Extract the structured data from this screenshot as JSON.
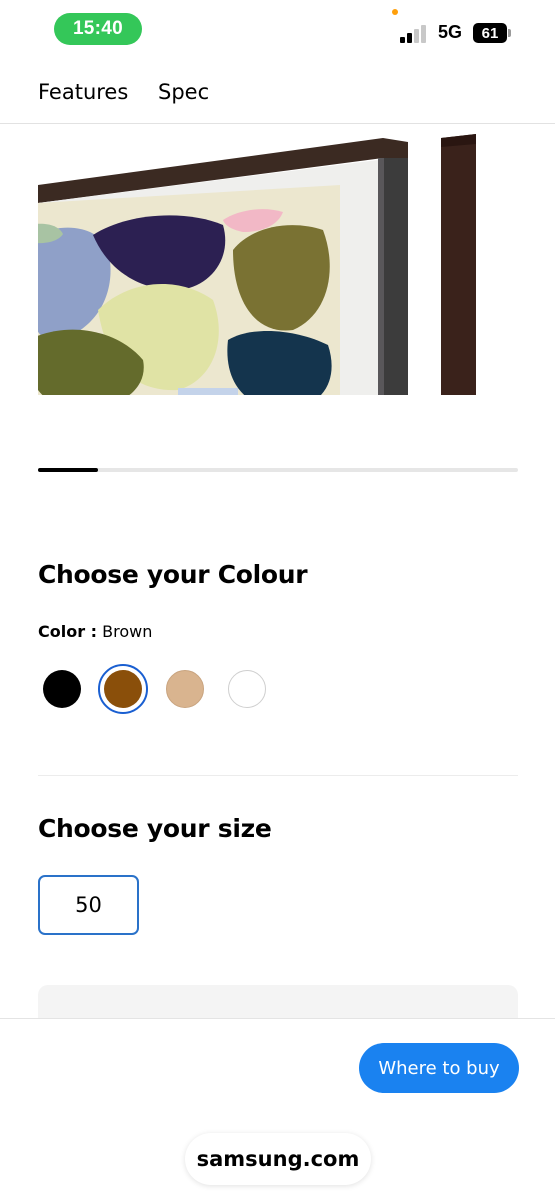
{
  "status_bar": {
    "time": "15:40",
    "network": "5G",
    "battery": "61",
    "signal_bars_active": 2,
    "signal_bars_total": 4
  },
  "tabs": [
    {
      "label": "Features"
    },
    {
      "label": "Spec"
    }
  ],
  "product_image": {
    "subject": "framed-tv-brown-bezel"
  },
  "carousel": {
    "active_index": 1,
    "total": 8
  },
  "colour_section": {
    "heading": "Choose your Colour",
    "label_key": "Color :",
    "selected_value": "Brown",
    "swatches": [
      {
        "name": "Black",
        "color": "#000000",
        "selected": false
      },
      {
        "name": "Brown",
        "color": "#8a4f0a",
        "selected": true
      },
      {
        "name": "Beige",
        "color": "#d9b48f",
        "selected": false
      },
      {
        "name": "White",
        "color": "#ffffff",
        "selected": false
      }
    ]
  },
  "size_section": {
    "heading": "Choose your size",
    "selected_size": "50"
  },
  "bottom_bar": {
    "buy_label": "Where to buy",
    "url": "samsung.com"
  },
  "colors": {
    "accent": "#1a82f0",
    "status_green": "#34c759",
    "selected_outline": "#2a72c9"
  }
}
